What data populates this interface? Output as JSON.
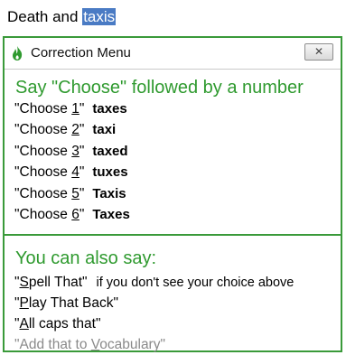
{
  "document": {
    "text_before": "Death and ",
    "selected_text": "taxis"
  },
  "menu": {
    "title": "Correction Menu",
    "close_glyph": "✕",
    "prompt": "Say \"Choose\" followed by a number",
    "choices": [
      {
        "prefix": "\"Choose ",
        "num": "1",
        "suffix": "\"",
        "word": "taxes"
      },
      {
        "prefix": "\"Choose ",
        "num": "2",
        "suffix": "\"",
        "word": "taxi"
      },
      {
        "prefix": "\"Choose ",
        "num": "3",
        "suffix": "\"",
        "word": "taxed"
      },
      {
        "prefix": "\"Choose ",
        "num": "4",
        "suffix": "\"",
        "word": "tuxes"
      },
      {
        "prefix": "\"Choose ",
        "num": "5",
        "suffix": "\"",
        "word": "Taxis"
      },
      {
        "prefix": "\"Choose ",
        "num": "6",
        "suffix": "\"",
        "word": "Taxes"
      }
    ],
    "also_heading": "You can also say:",
    "commands": [
      {
        "open": "\"",
        "key": "S",
        "rest": "pell That\"",
        "hint": "if you don't see your choice above"
      },
      {
        "open": "\"",
        "key": "P",
        "rest": "lay That Back\""
      },
      {
        "open": "\"",
        "key": "A",
        "rest": "ll caps that\""
      },
      {
        "open": "\"Add that to ",
        "key": "V",
        "rest": "ocabulary\""
      }
    ],
    "colors": {
      "accent": "#2f9a2f",
      "border": "#3a9a3a",
      "selection": "#4a7bc4",
      "disabled": "#8a8a8a"
    },
    "icons": {
      "app": "flame-icon",
      "close": "close-icon"
    }
  }
}
